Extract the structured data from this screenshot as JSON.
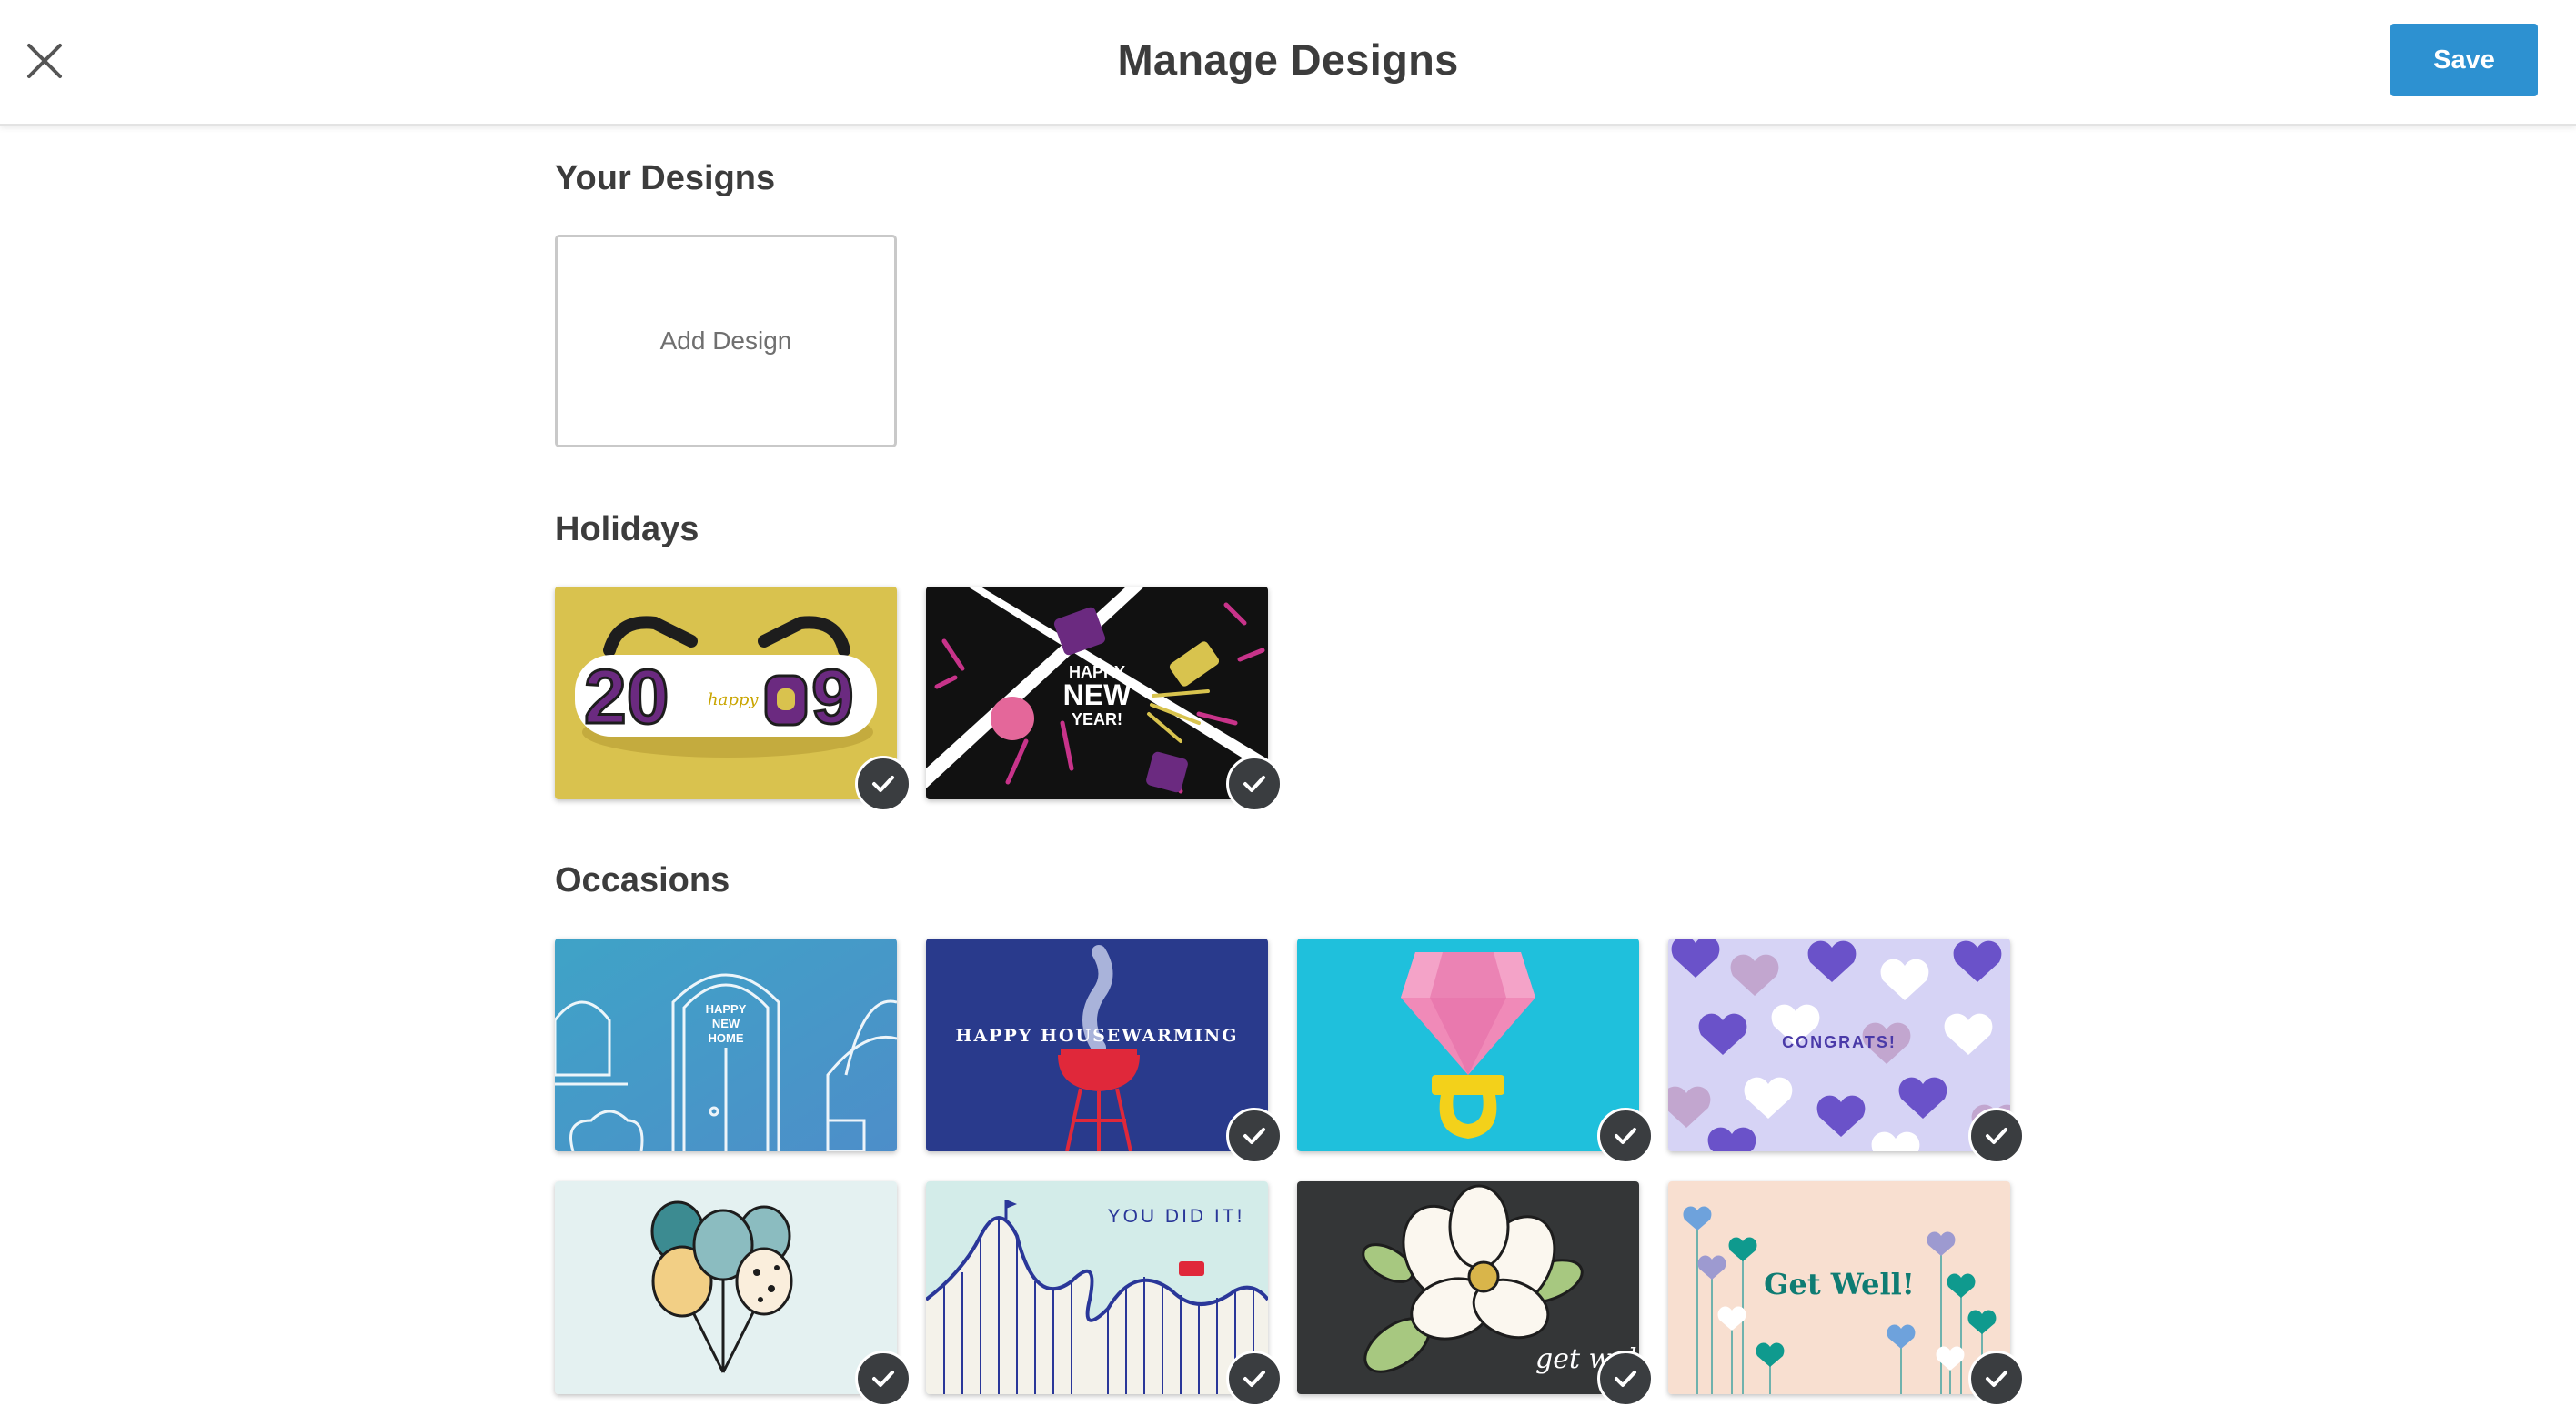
{
  "header": {
    "title": "Manage Designs",
    "save_label": "Save",
    "close_icon": "close-icon"
  },
  "your_designs": {
    "title": "Your Designs",
    "add_label": "Add Design"
  },
  "holidays": {
    "title": "Holidays",
    "cards": [
      {
        "name": "2019",
        "text_happy": "happy",
        "text_year_a": "20",
        "text_year_b": "9",
        "selected": true
      },
      {
        "name": "happy-new-year",
        "line1": "HAPPY",
        "line2": "NEW",
        "line3": "YEAR!",
        "selected": true
      }
    ]
  },
  "occasions": {
    "title": "Occasions",
    "cards": [
      {
        "name": "happy-new-home",
        "line1": "HAPPY",
        "line2": "NEW",
        "line3": "HOME",
        "selected": false
      },
      {
        "name": "happy-housewarming",
        "text": "HAPPY HOUSEWARMING",
        "selected": true
      },
      {
        "name": "ring",
        "selected": true
      },
      {
        "name": "congrats",
        "text": "CONGRATS!",
        "selected": true
      },
      {
        "name": "balloons",
        "selected": true
      },
      {
        "name": "you-did-it",
        "text": "YOU DID IT!",
        "selected": true
      },
      {
        "name": "get-well-magnolia",
        "text": "get well",
        "selected": true
      },
      {
        "name": "get-well-hearts",
        "text": "Get Well!",
        "selected": true
      }
    ]
  },
  "colors": {
    "accent": "#2d91d1",
    "check_badge": "#3a3d40"
  }
}
